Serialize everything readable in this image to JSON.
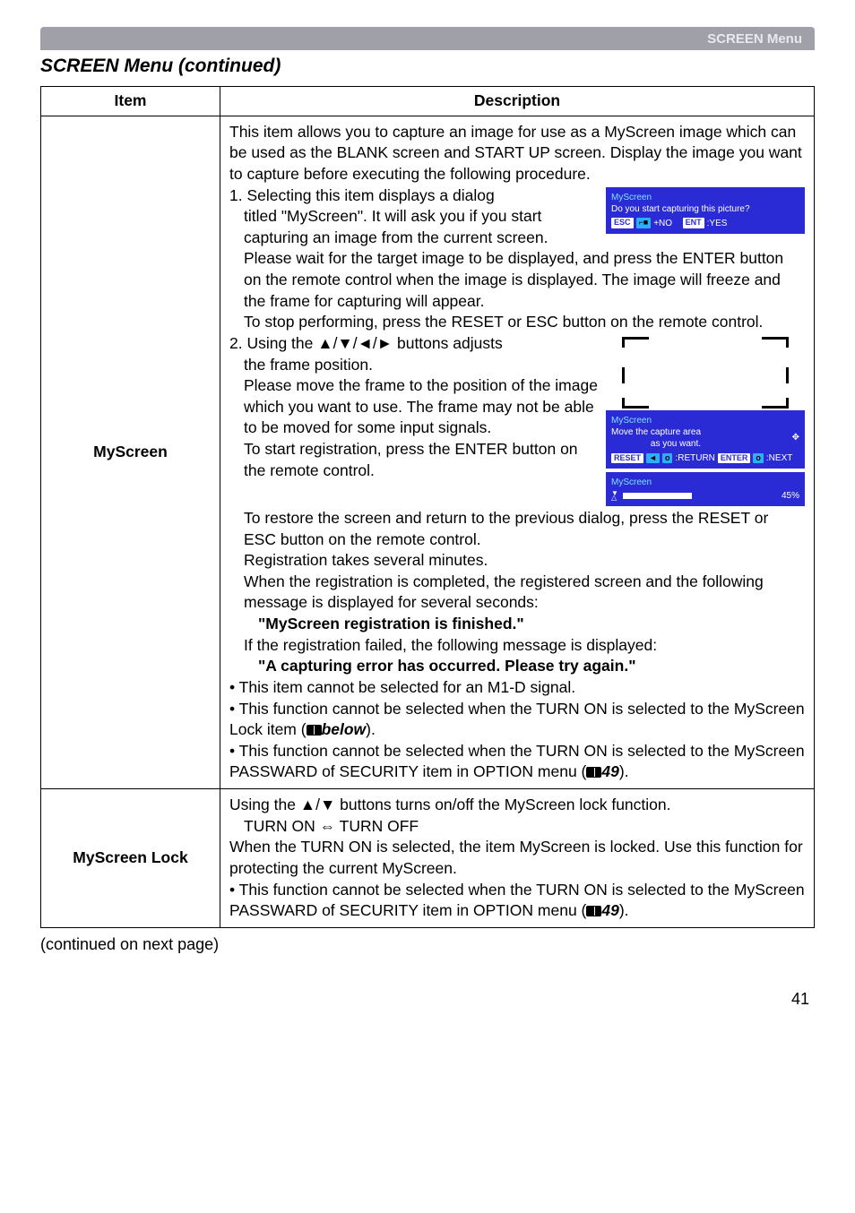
{
  "header": {
    "label": "SCREEN Menu"
  },
  "sectionTitle": "SCREEN Menu (continued)",
  "tableHeaders": {
    "item": "Item",
    "description": "Description"
  },
  "rows": {
    "myscreen": {
      "item": "MyScreen",
      "p1": "This item allows you to capture an image for use as a MyScreen image which can be used as the BLANK screen and START UP screen. Display the image you want to capture before executing the following procedure.",
      "s1a": "1. Selecting this item displays a dialog",
      "s1b": "titled \"MyScreen\". It will ask you if you start capturing an image from the current screen.",
      "s1c": "Please wait for the target image to be displayed, and press the ENTER button on the remote control when the image is displayed. The image will freeze and the frame for capturing will appear.",
      "s1d": "To stop performing, press the RESET or ESC button on the remote control.",
      "s2a": "2. Using the ▲/▼/◄/► buttons adjusts",
      "s2b": "the frame position.",
      "s2c": "Please move the frame to the position of the image which you want to use. The frame may not be able to be moved for some input signals.",
      "s2d": "To start registration, press the ENTER button on the remote control.",
      "s2e": "To restore the screen and return to the previous dialog, press the RESET or ESC button on the remote control.",
      "s2f": "Registration takes several minutes.",
      "s2g": "When the registration is completed, the registered screen and the following message is displayed for several seconds:",
      "msg1": "\"MyScreen registration is finished.\"",
      "s2h": "If the registration failed, the following message is displayed:",
      "msg2": "\"A capturing error has occurred. Please try again.\"",
      "b1": "• This item cannot be selected for an M1-D signal.",
      "b2a": "• This function cannot be selected when the TURN ON is selected to the MyScreen Lock item (",
      "b2b": "below",
      "b2c": ").",
      "b3a": "• This function cannot be selected when the TURN ON is selected to the MyScreen PASSWARD of SECURITY item in OPTION menu (",
      "b3b": "49",
      "b3c": ").",
      "dialog1": {
        "title": "MyScreen",
        "body": "Do you start capturing this picture?",
        "esc": "ESC",
        "plusNo": "+NO",
        "ent": "ENT",
        "yes": ":YES"
      },
      "dialog2": {
        "title": "MyScreen",
        "line1": "Move the capture area",
        "line2": "as you want.",
        "reset": "RESET",
        "return": ":RETURN",
        "enter": "ENTER",
        "next": ":NEXT"
      },
      "dialog3": {
        "title": "MyScreen",
        "percent": "45%"
      }
    },
    "myscreenlock": {
      "item": "MyScreen Lock",
      "p1": "Using the ▲/▼ buttons turns on/off the MyScreen lock function.",
      "toggle": "TURN ON ⇔ TURN OFF",
      "p2": "When the TURN ON is selected, the item MyScreen is locked. Use this function for protecting the current MyScreen.",
      "b1a": "• This function cannot be selected when the TURN ON is selected to the MyScreen PASSWARD of SECURITY item in OPTION menu (",
      "b1b": "49",
      "b1c": ")."
    }
  },
  "continued": "(continued on next page)",
  "pageNum": "41"
}
